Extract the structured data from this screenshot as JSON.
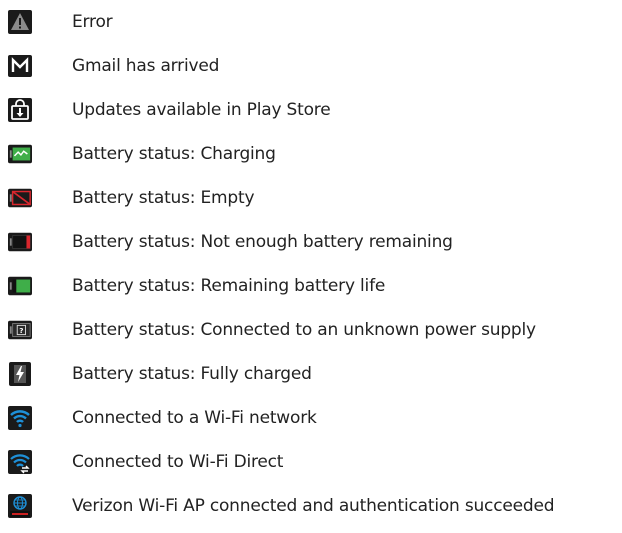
{
  "items": [
    {
      "icon": "error-icon",
      "label": "Error"
    },
    {
      "icon": "gmail-icon",
      "label": "Gmail has arrived"
    },
    {
      "icon": "play-store-update-icon",
      "label": "Updates available in Play Store"
    },
    {
      "icon": "battery-charging-icon",
      "label": "Battery status: Charging"
    },
    {
      "icon": "battery-empty-icon",
      "label": "Battery status: Empty"
    },
    {
      "icon": "battery-low-icon",
      "label": "Battery status: Not enough battery remaining"
    },
    {
      "icon": "battery-remaining-icon",
      "label": "Battery status: Remaining battery life"
    },
    {
      "icon": "battery-unknown-power-icon",
      "label": "Battery status: Connected to an unknown power supply"
    },
    {
      "icon": "battery-full-icon",
      "label": "Battery status: Fully charged"
    },
    {
      "icon": "wifi-connected-icon",
      "label": "Connected to a Wi-Fi network"
    },
    {
      "icon": "wifi-direct-icon",
      "label": "Connected to Wi-Fi Direct"
    },
    {
      "icon": "verizon-wifi-ap-icon",
      "label": "Verizon Wi-Fi AP connected and authentication succeeded"
    }
  ],
  "colors": {
    "text": "#222222",
    "icon_dark": "#1a1a1a",
    "battery_green": "#3fae49",
    "battery_red": "#d9262d",
    "wifi_blue": "#1e90d8"
  }
}
